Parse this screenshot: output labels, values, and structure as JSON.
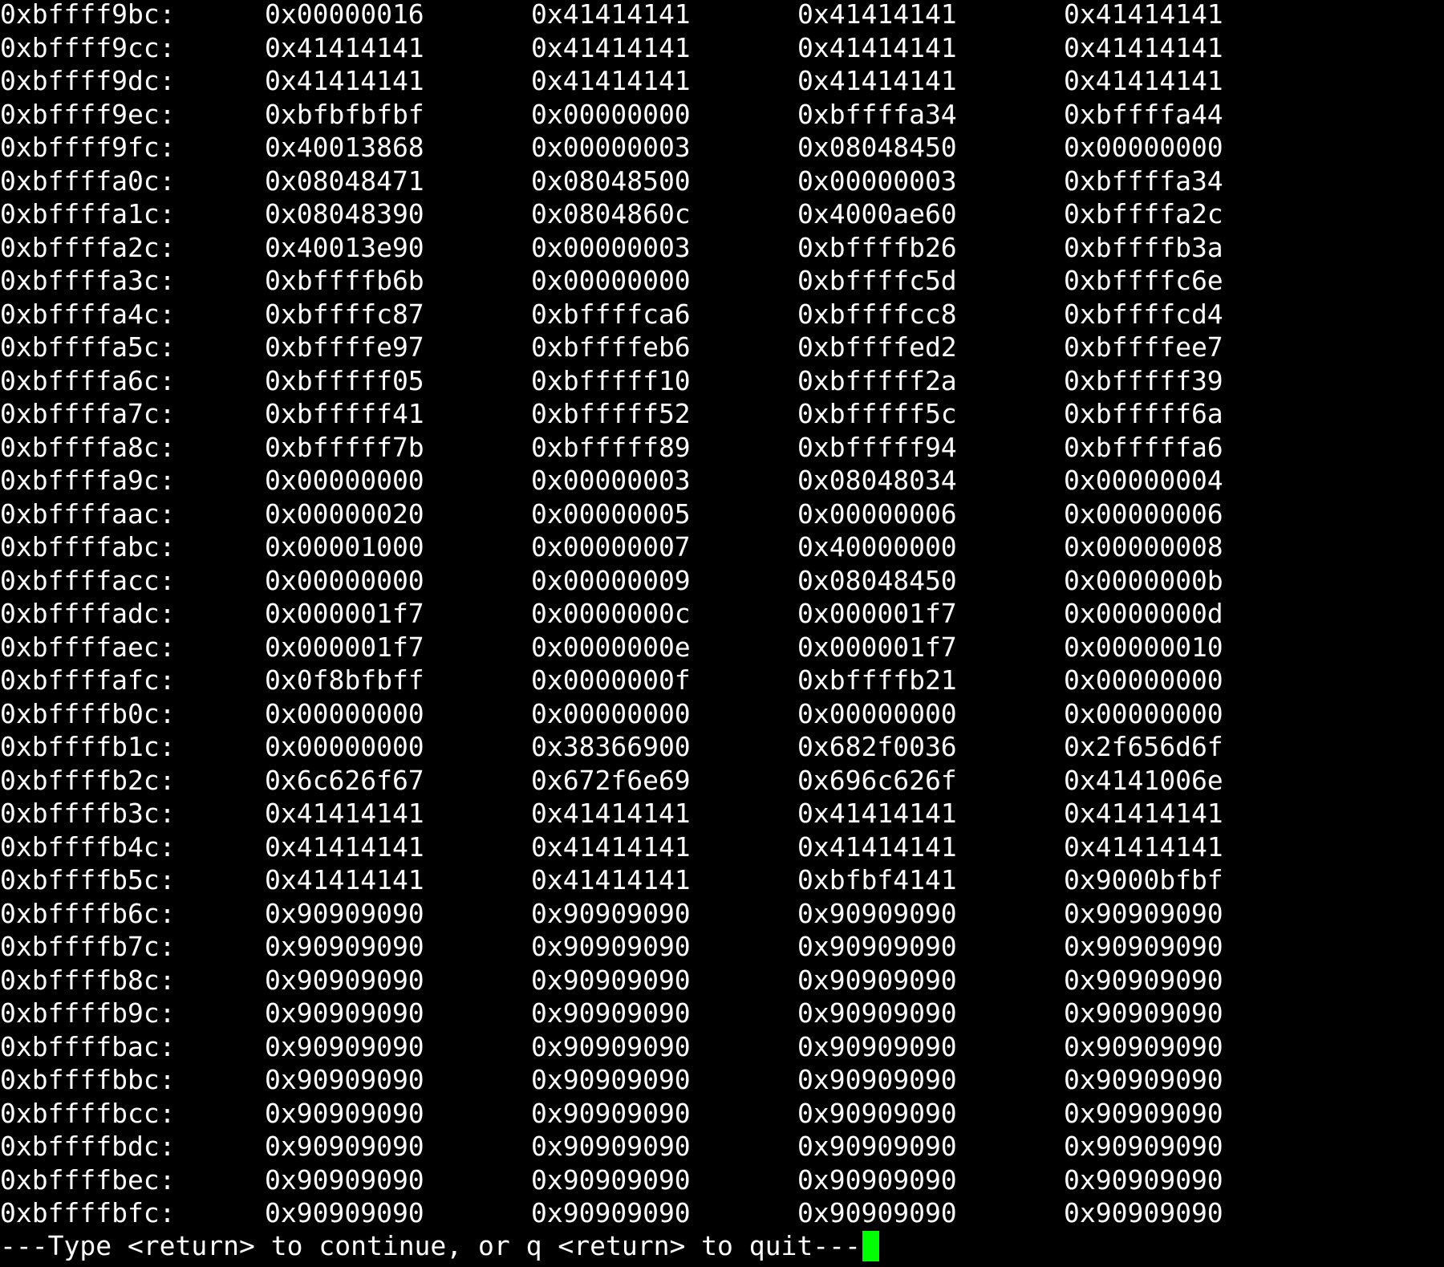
{
  "terminal": {
    "accent_color": "#00ff00",
    "rows": [
      {
        "addr": "0xbffff9bc:",
        "words": [
          "0x00000016",
          "0x41414141",
          "0x41414141",
          "0x41414141"
        ]
      },
      {
        "addr": "0xbffff9cc:",
        "words": [
          "0x41414141",
          "0x41414141",
          "0x41414141",
          "0x41414141"
        ]
      },
      {
        "addr": "0xbffff9dc:",
        "words": [
          "0x41414141",
          "0x41414141",
          "0x41414141",
          "0x41414141"
        ]
      },
      {
        "addr": "0xbffff9ec:",
        "words": [
          "0xbfbfbfbf",
          "0x00000000",
          "0xbffffa34",
          "0xbffffa44"
        ]
      },
      {
        "addr": "0xbffff9fc:",
        "words": [
          "0x40013868",
          "0x00000003",
          "0x08048450",
          "0x00000000"
        ]
      },
      {
        "addr": "0xbffffa0c:",
        "words": [
          "0x08048471",
          "0x08048500",
          "0x00000003",
          "0xbffffa34"
        ]
      },
      {
        "addr": "0xbffffa1c:",
        "words": [
          "0x08048390",
          "0x0804860c",
          "0x4000ae60",
          "0xbffffa2c"
        ]
      },
      {
        "addr": "0xbffffa2c:",
        "words": [
          "0x40013e90",
          "0x00000003",
          "0xbffffb26",
          "0xbffffb3a"
        ]
      },
      {
        "addr": "0xbffffa3c:",
        "words": [
          "0xbffffb6b",
          "0x00000000",
          "0xbffffc5d",
          "0xbffffc6e"
        ]
      },
      {
        "addr": "0xbffffa4c:",
        "words": [
          "0xbffffc87",
          "0xbffffca6",
          "0xbffffcc8",
          "0xbffffcd4"
        ]
      },
      {
        "addr": "0xbffffa5c:",
        "words": [
          "0xbffffe97",
          "0xbffffeb6",
          "0xbffffed2",
          "0xbffffee7"
        ]
      },
      {
        "addr": "0xbffffa6c:",
        "words": [
          "0xbfffff05",
          "0xbfffff10",
          "0xbfffff2a",
          "0xbfffff39"
        ]
      },
      {
        "addr": "0xbffffa7c:",
        "words": [
          "0xbfffff41",
          "0xbfffff52",
          "0xbfffff5c",
          "0xbfffff6a"
        ]
      },
      {
        "addr": "0xbffffa8c:",
        "words": [
          "0xbfffff7b",
          "0xbfffff89",
          "0xbfffff94",
          "0xbfffffa6"
        ]
      },
      {
        "addr": "0xbffffa9c:",
        "words": [
          "0x00000000",
          "0x00000003",
          "0x08048034",
          "0x00000004"
        ]
      },
      {
        "addr": "0xbffffaac:",
        "words": [
          "0x00000020",
          "0x00000005",
          "0x00000006",
          "0x00000006"
        ]
      },
      {
        "addr": "0xbffffabc:",
        "words": [
          "0x00001000",
          "0x00000007",
          "0x40000000",
          "0x00000008"
        ]
      },
      {
        "addr": "0xbffffacc:",
        "words": [
          "0x00000000",
          "0x00000009",
          "0x08048450",
          "0x0000000b"
        ]
      },
      {
        "addr": "0xbffffadc:",
        "words": [
          "0x000001f7",
          "0x0000000c",
          "0x000001f7",
          "0x0000000d"
        ]
      },
      {
        "addr": "0xbffffaec:",
        "words": [
          "0x000001f7",
          "0x0000000e",
          "0x000001f7",
          "0x00000010"
        ]
      },
      {
        "addr": "0xbffffafc:",
        "words": [
          "0x0f8bfbff",
          "0x0000000f",
          "0xbffffb21",
          "0x00000000"
        ]
      },
      {
        "addr": "0xbffffb0c:",
        "words": [
          "0x00000000",
          "0x00000000",
          "0x00000000",
          "0x00000000"
        ]
      },
      {
        "addr": "0xbffffb1c:",
        "words": [
          "0x00000000",
          "0x38366900",
          "0x682f0036",
          "0x2f656d6f"
        ]
      },
      {
        "addr": "0xbffffb2c:",
        "words": [
          "0x6c626f67",
          "0x672f6e69",
          "0x696c626f",
          "0x4141006e"
        ]
      },
      {
        "addr": "0xbffffb3c:",
        "words": [
          "0x41414141",
          "0x41414141",
          "0x41414141",
          "0x41414141"
        ]
      },
      {
        "addr": "0xbffffb4c:",
        "words": [
          "0x41414141",
          "0x41414141",
          "0x41414141",
          "0x41414141"
        ]
      },
      {
        "addr": "0xbffffb5c:",
        "words": [
          "0x41414141",
          "0x41414141",
          "0xbfbf4141",
          "0x9000bfbf"
        ]
      },
      {
        "addr": "0xbffffb6c:",
        "words": [
          "0x90909090",
          "0x90909090",
          "0x90909090",
          "0x90909090"
        ]
      },
      {
        "addr": "0xbffffb7c:",
        "words": [
          "0x90909090",
          "0x90909090",
          "0x90909090",
          "0x90909090"
        ]
      },
      {
        "addr": "0xbffffb8c:",
        "words": [
          "0x90909090",
          "0x90909090",
          "0x90909090",
          "0x90909090"
        ]
      },
      {
        "addr": "0xbffffb9c:",
        "words": [
          "0x90909090",
          "0x90909090",
          "0x90909090",
          "0x90909090"
        ]
      },
      {
        "addr": "0xbffffbac:",
        "words": [
          "0x90909090",
          "0x90909090",
          "0x90909090",
          "0x90909090"
        ]
      },
      {
        "addr": "0xbffffbbc:",
        "words": [
          "0x90909090",
          "0x90909090",
          "0x90909090",
          "0x90909090"
        ]
      },
      {
        "addr": "0xbffffbcc:",
        "words": [
          "0x90909090",
          "0x90909090",
          "0x90909090",
          "0x90909090"
        ]
      },
      {
        "addr": "0xbffffbdc:",
        "words": [
          "0x90909090",
          "0x90909090",
          "0x90909090",
          "0x90909090"
        ]
      },
      {
        "addr": "0xbffffbec:",
        "words": [
          "0x90909090",
          "0x90909090",
          "0x90909090",
          "0x90909090"
        ]
      },
      {
        "addr": "0xbffffbfc:",
        "words": [
          "0x90909090",
          "0x90909090",
          "0x90909090",
          "0x90909090"
        ]
      }
    ],
    "pager_prompt": "---Type <return> to continue, or q <return> to quit---"
  }
}
